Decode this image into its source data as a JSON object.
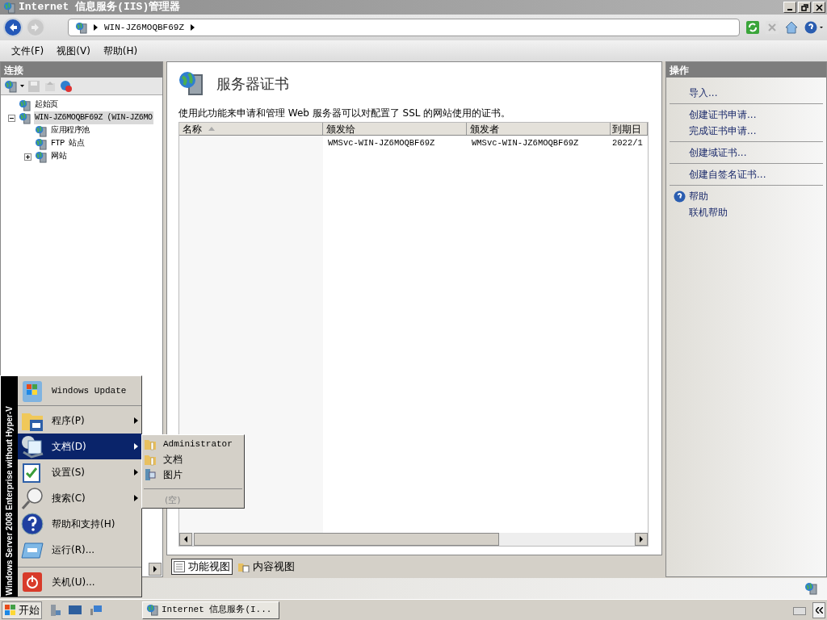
{
  "window": {
    "title": "Internet 信息服务(IIS)管理器"
  },
  "address": {
    "crumbs": [
      "WIN-JZ6MOQBF69Z"
    ]
  },
  "menu_bar": [
    "文件(F)",
    "视图(V)",
    "帮助(H)"
  ],
  "connections": {
    "title": "连接",
    "tree": [
      {
        "label": "起始页",
        "has_expander": false,
        "selected": false
      },
      {
        "label": "WIN-JZ6MOQBF69Z (WIN-JZ6MO",
        "has_expander": true,
        "expanded": true,
        "selected": true,
        "children": [
          {
            "label": "应用程序池",
            "has_expander": false,
            "selected": false
          },
          {
            "label": "FTP 站点",
            "has_expander": false,
            "selected": false
          },
          {
            "label": "网站",
            "has_expander": true,
            "expanded": false,
            "selected": false
          }
        ]
      }
    ]
  },
  "feature": {
    "title": "服务器证书",
    "description": "使用此功能来申请和管理 Web 服务器可以对配置了 SSL 的网站使用的证书。",
    "table": {
      "columns": [
        {
          "label": "名称",
          "sorted": true
        },
        {
          "label": "颁发给",
          "sorted": false
        },
        {
          "label": "颁发者",
          "sorted": false
        },
        {
          "label": "到期日",
          "sorted": false
        }
      ],
      "rows": [
        [
          "",
          "WMSvc-WIN-JZ6MOQBF69Z",
          "WMSvc-WIN-JZ6MOQBF69Z",
          "2022/1"
        ]
      ]
    }
  },
  "view_tabs": [
    {
      "label": "功能视图",
      "selected": true
    },
    {
      "label": "内容视图",
      "selected": false
    }
  ],
  "actions": {
    "title": "操作",
    "groups": [
      [
        {
          "label": "导入...",
          "kind": "link"
        }
      ],
      [
        {
          "label": "创建证书申请...",
          "kind": "link"
        },
        {
          "label": "完成证书申请...",
          "kind": "link"
        }
      ],
      [
        {
          "label": "创建域证书...",
          "kind": "link"
        }
      ],
      [
        {
          "label": "创建自签名证书...",
          "kind": "link"
        }
      ],
      [
        {
          "label": "帮助",
          "kind": "help"
        },
        {
          "label": "联机帮助",
          "kind": "link"
        }
      ]
    ]
  },
  "start_menu": {
    "side_text": "Windows Server 2008 Enterprise without Hyper-V",
    "sections": [
      [
        {
          "label": "Windows Update",
          "kind": "update",
          "submenu": false,
          "selected": false
        }
      ],
      [
        {
          "label": "程序(P)",
          "kind": "programs",
          "submenu": true,
          "selected": false
        },
        {
          "label": "文档(D)",
          "kind": "documents",
          "submenu": true,
          "selected": true
        },
        {
          "label": "设置(S)",
          "kind": "settings",
          "submenu": true,
          "selected": false
        },
        {
          "label": "搜索(C)",
          "kind": "search",
          "submenu": true,
          "selected": false
        },
        {
          "label": "帮助和支持(H)",
          "kind": "help",
          "submenu": false,
          "selected": false
        },
        {
          "label": "运行(R)...",
          "kind": "run",
          "submenu": false,
          "selected": false
        }
      ],
      [
        {
          "label": "关机(U)...",
          "kind": "shutdown",
          "submenu": false,
          "selected": false
        }
      ]
    ]
  },
  "submenu": {
    "items": [
      {
        "label": "Administrator",
        "kind": "folder"
      },
      {
        "label": "文档",
        "kind": "folder"
      },
      {
        "label": "图片",
        "kind": "library"
      }
    ],
    "empty_label": "(空)"
  },
  "taskbar": {
    "start_label": "开始",
    "tasks": [
      {
        "label": "Internet 信息服务(I..."
      }
    ]
  }
}
